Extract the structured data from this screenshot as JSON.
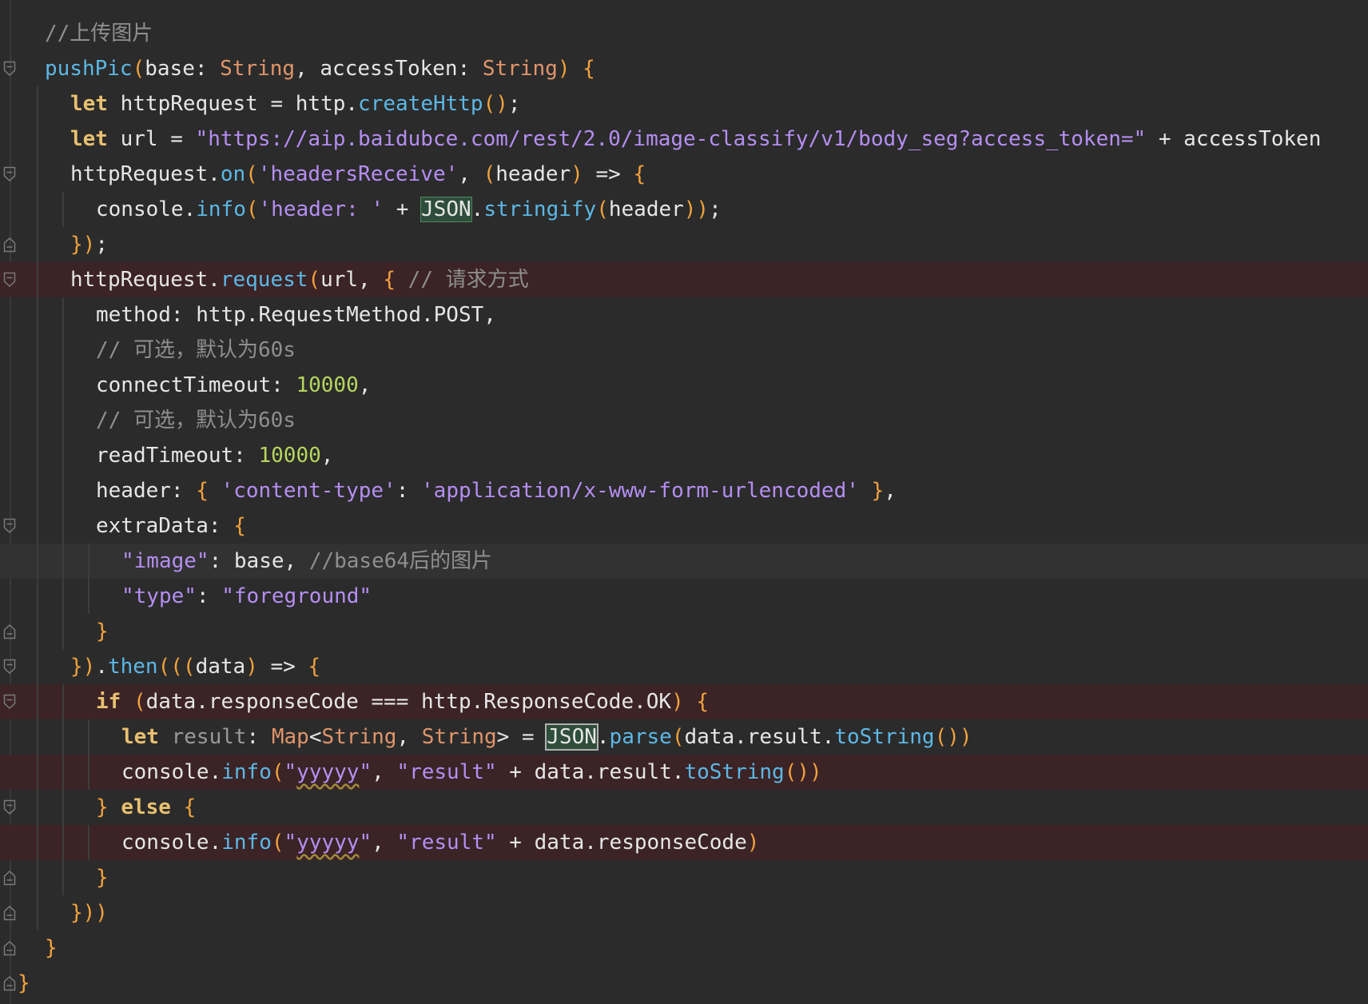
{
  "lines": [
    {
      "indent": 1,
      "tokens": [
        {
          "c": "cm",
          "t": "//上传图片"
        }
      ]
    },
    {
      "indent": 1,
      "fold": "open",
      "tokens": [
        {
          "c": "fn",
          "t": "pushPic"
        },
        {
          "c": "br",
          "t": "("
        },
        {
          "c": "pl",
          "t": "base: "
        },
        {
          "c": "ty",
          "t": "String"
        },
        {
          "c": "pl",
          "t": ", accessToken: "
        },
        {
          "c": "ty",
          "t": "String"
        },
        {
          "c": "br",
          "t": ") {"
        }
      ]
    },
    {
      "indent": 2,
      "tokens": [
        {
          "c": "kw",
          "t": "let "
        },
        {
          "c": "pl",
          "t": "httpRequest = http."
        },
        {
          "c": "fn",
          "t": "createHttp"
        },
        {
          "c": "br",
          "t": "()"
        },
        {
          "c": "pl",
          "t": ";"
        }
      ]
    },
    {
      "indent": 2,
      "tokens": [
        {
          "c": "kw",
          "t": "let "
        },
        {
          "c": "pl",
          "t": "url = "
        },
        {
          "c": "str",
          "t": "\"https://aip.baidubce.com/rest/2.0/image-classify/v1/body_seg?access_token=\""
        },
        {
          "c": "pl",
          "t": " + accessToken"
        }
      ]
    },
    {
      "indent": 2,
      "fold": "open",
      "tokens": [
        {
          "c": "pl",
          "t": "httpRequest."
        },
        {
          "c": "fn",
          "t": "on"
        },
        {
          "c": "br",
          "t": "("
        },
        {
          "c": "str",
          "t": "'headersReceive'"
        },
        {
          "c": "pl",
          "t": ", "
        },
        {
          "c": "br",
          "t": "("
        },
        {
          "c": "pl",
          "t": "header"
        },
        {
          "c": "br",
          "t": ")"
        },
        {
          "c": "pl",
          "t": " => "
        },
        {
          "c": "br",
          "t": "{"
        }
      ]
    },
    {
      "indent": 3,
      "tokens": [
        {
          "c": "pl",
          "t": "console."
        },
        {
          "c": "fn",
          "t": "info"
        },
        {
          "c": "br",
          "t": "("
        },
        {
          "c": "str",
          "t": "'header: '"
        },
        {
          "c": "pl",
          "t": " + "
        },
        {
          "c": "json",
          "t": "JSON"
        },
        {
          "c": "pl",
          "t": "."
        },
        {
          "c": "fn",
          "t": "stringify"
        },
        {
          "c": "br",
          "t": "("
        },
        {
          "c": "pl",
          "t": "header"
        },
        {
          "c": "br",
          "t": "))"
        },
        {
          "c": "pl",
          "t": ";"
        }
      ]
    },
    {
      "indent": 2,
      "fold": "close",
      "tokens": [
        {
          "c": "br",
          "t": "})"
        },
        {
          "c": "pl",
          "t": ";"
        }
      ]
    },
    {
      "indent": 2,
      "fold": "open",
      "hl": "red",
      "tokens": [
        {
          "c": "pl",
          "t": "httpRequest."
        },
        {
          "c": "fn",
          "t": "request"
        },
        {
          "c": "br",
          "t": "("
        },
        {
          "c": "pl",
          "t": "url, "
        },
        {
          "c": "br",
          "t": "{"
        },
        {
          "c": "cm",
          "t": " // 请求方式"
        }
      ]
    },
    {
      "indent": 3,
      "tokens": [
        {
          "c": "pl",
          "t": "method: http.RequestMethod.POST,"
        }
      ]
    },
    {
      "indent": 3,
      "tokens": [
        {
          "c": "cm",
          "t": "// 可选，默认为60s"
        }
      ]
    },
    {
      "indent": 3,
      "tokens": [
        {
          "c": "pl",
          "t": "connectTimeout: "
        },
        {
          "c": "num",
          "t": "10000"
        },
        {
          "c": "pl",
          "t": ","
        }
      ]
    },
    {
      "indent": 3,
      "tokens": [
        {
          "c": "cm",
          "t": "// 可选，默认为60s"
        }
      ]
    },
    {
      "indent": 3,
      "tokens": [
        {
          "c": "pl",
          "t": "readTimeout: "
        },
        {
          "c": "num",
          "t": "10000"
        },
        {
          "c": "pl",
          "t": ","
        }
      ]
    },
    {
      "indent": 3,
      "tokens": [
        {
          "c": "pl",
          "t": "header: "
        },
        {
          "c": "br",
          "t": "{"
        },
        {
          "c": "pl",
          "t": " "
        },
        {
          "c": "str",
          "t": "'content-type'"
        },
        {
          "c": "pl",
          "t": ": "
        },
        {
          "c": "str",
          "t": "'application/x-www-form-urlencoded'"
        },
        {
          "c": "pl",
          "t": " "
        },
        {
          "c": "br",
          "t": "}"
        },
        {
          "c": "pl",
          "t": ","
        }
      ]
    },
    {
      "indent": 3,
      "fold": "open",
      "tokens": [
        {
          "c": "pl",
          "t": "extraData: "
        },
        {
          "c": "br",
          "t": "{"
        }
      ]
    },
    {
      "indent": 4,
      "hl": "grey",
      "tokens": [
        {
          "c": "str",
          "t": "\"image\""
        },
        {
          "c": "pl",
          "t": ": base, "
        },
        {
          "c": "cm",
          "t": "//base64后的图片"
        }
      ]
    },
    {
      "indent": 4,
      "tokens": [
        {
          "c": "str",
          "t": "\"type\""
        },
        {
          "c": "pl",
          "t": ": "
        },
        {
          "c": "str",
          "t": "\"foreground\""
        }
      ]
    },
    {
      "indent": 3,
      "fold": "close",
      "tokens": [
        {
          "c": "br",
          "t": "}"
        }
      ]
    },
    {
      "indent": 2,
      "fold": "open",
      "tokens": [
        {
          "c": "br",
          "t": "})"
        },
        {
          "c": "pl",
          "t": "."
        },
        {
          "c": "fn",
          "t": "then"
        },
        {
          "c": "br",
          "t": "((("
        },
        {
          "c": "pl",
          "t": "data"
        },
        {
          "c": "br",
          "t": ")"
        },
        {
          "c": "pl",
          "t": " => "
        },
        {
          "c": "br",
          "t": "{"
        }
      ]
    },
    {
      "indent": 3,
      "fold": "open",
      "hl": "red",
      "tokens": [
        {
          "c": "kw",
          "t": "if "
        },
        {
          "c": "br",
          "t": "("
        },
        {
          "c": "pl",
          "t": "data.responseCode === http.ResponseCode.OK"
        },
        {
          "c": "br",
          "t": ")"
        },
        {
          "c": "pl",
          "t": " "
        },
        {
          "c": "br",
          "t": "{"
        }
      ]
    },
    {
      "indent": 4,
      "tokens": [
        {
          "c": "kw",
          "t": "let "
        },
        {
          "c": "dim",
          "t": "result"
        },
        {
          "c": "pl",
          "t": ": "
        },
        {
          "c": "ty",
          "t": "Map"
        },
        {
          "c": "pl",
          "t": "<"
        },
        {
          "c": "ty",
          "t": "String"
        },
        {
          "c": "pl",
          "t": ", "
        },
        {
          "c": "ty",
          "t": "String"
        },
        {
          "c": "pl",
          "t": "> = "
        },
        {
          "c": "json2",
          "t": "JSON"
        },
        {
          "c": "pl",
          "t": "."
        },
        {
          "c": "fn",
          "t": "parse"
        },
        {
          "c": "br",
          "t": "("
        },
        {
          "c": "pl",
          "t": "data.result."
        },
        {
          "c": "fn",
          "t": "toString"
        },
        {
          "c": "br",
          "t": "())"
        }
      ]
    },
    {
      "indent": 4,
      "hl": "red",
      "tokens": [
        {
          "c": "pl",
          "t": "console."
        },
        {
          "c": "fn",
          "t": "info"
        },
        {
          "c": "br",
          "t": "("
        },
        {
          "c": "str",
          "t": "\""
        },
        {
          "c": "strsq",
          "t": "yyyyy"
        },
        {
          "c": "str",
          "t": "\""
        },
        {
          "c": "pl",
          "t": ", "
        },
        {
          "c": "str",
          "t": "\"result\""
        },
        {
          "c": "pl",
          "t": " + data.result."
        },
        {
          "c": "fn",
          "t": "toString"
        },
        {
          "c": "br",
          "t": "())"
        }
      ]
    },
    {
      "indent": 3,
      "fold": "open",
      "tokens": [
        {
          "c": "br",
          "t": "}"
        },
        {
          "c": "pl",
          "t": " "
        },
        {
          "c": "kw",
          "t": "else "
        },
        {
          "c": "br",
          "t": "{"
        }
      ]
    },
    {
      "indent": 4,
      "hl": "red",
      "tokens": [
        {
          "c": "pl",
          "t": "console."
        },
        {
          "c": "fn",
          "t": "info"
        },
        {
          "c": "br",
          "t": "("
        },
        {
          "c": "str",
          "t": "\""
        },
        {
          "c": "strsq",
          "t": "yyyyy"
        },
        {
          "c": "str",
          "t": "\""
        },
        {
          "c": "pl",
          "t": ", "
        },
        {
          "c": "str",
          "t": "\"result\""
        },
        {
          "c": "pl",
          "t": " + data.responseCode"
        },
        {
          "c": "br",
          "t": ")"
        }
      ]
    },
    {
      "indent": 3,
      "fold": "close",
      "tokens": [
        {
          "c": "br",
          "t": "}"
        }
      ]
    },
    {
      "indent": 2,
      "fold": "close",
      "tokens": [
        {
          "c": "br",
          "t": "}))"
        }
      ]
    },
    {
      "indent": 1,
      "fold": "close",
      "tokens": [
        {
          "c": "br",
          "t": "}"
        }
      ]
    },
    {
      "indent": 0,
      "fold": "close",
      "tokens": [
        {
          "c": "br",
          "t": "}"
        }
      ]
    }
  ]
}
